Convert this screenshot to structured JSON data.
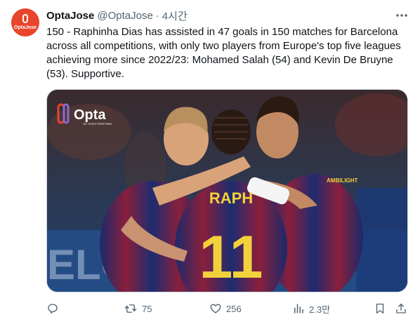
{
  "tweet": {
    "author_name": "OptaJose",
    "handle": "@OptaJose",
    "separator": "·",
    "time": "4시간",
    "text": "150 - Raphinha Dias has assisted in 47 goals in 150 matches for Barcelona across all competitions, with only two players from Europe's top five leagues achieving more since 2022/23: Mohamed Salah (54) and Kevin De Bruyne (53). Supportive."
  },
  "avatar": {
    "logo_text": "OptaJose"
  },
  "media": {
    "watermark_text": "Opta",
    "watermark_sub": "BY STATS PERFORM",
    "jersey_name": "RAPH",
    "jersey_number": "11",
    "stadium_letters": "ELO",
    "sponsor_text": "AMBILIGHT"
  },
  "actions": {
    "replies": "",
    "retweets": "75",
    "likes": "256",
    "views": "2.3만"
  },
  "colors": {
    "brand": "#e8452c",
    "text_primary": "#0f1419",
    "text_secondary": "#536471",
    "border": "#cfd9de"
  }
}
